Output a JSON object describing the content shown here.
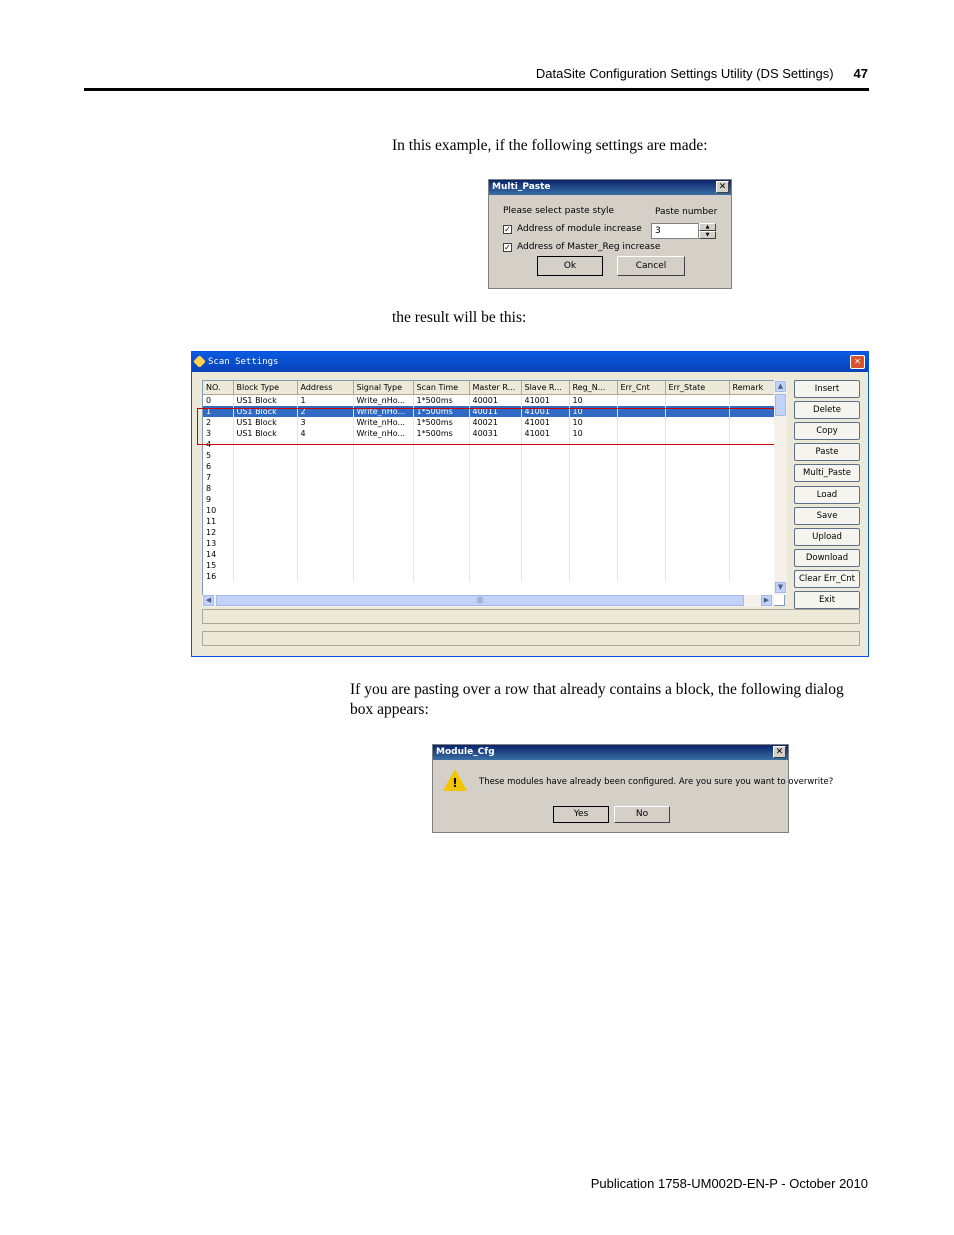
{
  "header": {
    "title": "DataSite Configuration Settings Utility (DS Settings)",
    "page": "47"
  },
  "text": {
    "p1": "In this example, if the following settings are made:",
    "p2": "the result will be this:",
    "p3": "If you are pasting over a row that already contains a block, the following dialog box appears:"
  },
  "multi_paste": {
    "title": "Multi_Paste",
    "close": "✕",
    "prompt": "Please select paste style",
    "paste_number_label": "Paste number",
    "paste_number": "3",
    "chk1_label": "Address of module increase",
    "chk2_label": "Address of Master_Reg increase",
    "check_glyph": "✓",
    "ok": "Ok",
    "cancel": "Cancel"
  },
  "scan": {
    "title": "Scan Settings",
    "close": "✕",
    "columns": [
      "NO.",
      "Block Type",
      "Address",
      "Signal Type",
      "Scan Time",
      "Master R...",
      "Slave R...",
      "Reg_N...",
      "Err_Cnt",
      "Err_State",
      "Remark"
    ],
    "rows": [
      [
        "0",
        "US1 Block",
        "1",
        "Write_nHo...",
        "1*500ms",
        "40001",
        "41001",
        "10",
        "",
        "",
        ""
      ],
      [
        "1",
        "US1 Block",
        "2",
        "Write_nHo...",
        "1*500ms",
        "40011",
        "41001",
        "10",
        "",
        "",
        ""
      ],
      [
        "2",
        "US1 Block",
        "3",
        "Write_nHo...",
        "1*500ms",
        "40021",
        "41001",
        "10",
        "",
        "",
        ""
      ],
      [
        "3",
        "US1 Block",
        "4",
        "Write_nHo...",
        "1*500ms",
        "40031",
        "41001",
        "10",
        "",
        "",
        ""
      ],
      [
        "4",
        "",
        "",
        "",
        "",
        "",
        "",
        "",
        "",
        "",
        ""
      ],
      [
        "5",
        "",
        "",
        "",
        "",
        "",
        "",
        "",
        "",
        "",
        ""
      ],
      [
        "6",
        "",
        "",
        "",
        "",
        "",
        "",
        "",
        "",
        "",
        ""
      ],
      [
        "7",
        "",
        "",
        "",
        "",
        "",
        "",
        "",
        "",
        "",
        ""
      ],
      [
        "8",
        "",
        "",
        "",
        "",
        "",
        "",
        "",
        "",
        "",
        ""
      ],
      [
        "9",
        "",
        "",
        "",
        "",
        "",
        "",
        "",
        "",
        "",
        ""
      ],
      [
        "10",
        "",
        "",
        "",
        "",
        "",
        "",
        "",
        "",
        "",
        ""
      ],
      [
        "11",
        "",
        "",
        "",
        "",
        "",
        "",
        "",
        "",
        "",
        ""
      ],
      [
        "12",
        "",
        "",
        "",
        "",
        "",
        "",
        "",
        "",
        "",
        ""
      ],
      [
        "13",
        "",
        "",
        "",
        "",
        "",
        "",
        "",
        "",
        "",
        ""
      ],
      [
        "14",
        "",
        "",
        "",
        "",
        "",
        "",
        "",
        "",
        "",
        ""
      ],
      [
        "15",
        "",
        "",
        "",
        "",
        "",
        "",
        "",
        "",
        "",
        ""
      ],
      [
        "16",
        "",
        "",
        "",
        "",
        "",
        "",
        "",
        "",
        "",
        ""
      ]
    ],
    "selected_row": 1,
    "buttons": [
      "Insert",
      "Delete",
      "Copy",
      "Paste",
      "Multi_Paste",
      "Load",
      "Save",
      "Upload",
      "Download",
      "Clear Err_Cnt",
      "Exit"
    ],
    "scroll_mid": "|||"
  },
  "module_cfg": {
    "title": "Module_Cfg",
    "close": "✕",
    "message": "These modules have already been configured. Are you sure you want to overwrite?",
    "warn_glyph": "!",
    "yes": "Yes",
    "no": "No"
  },
  "footer": {
    "text": "Publication 1758-UM002D-EN-P - October 2010"
  }
}
